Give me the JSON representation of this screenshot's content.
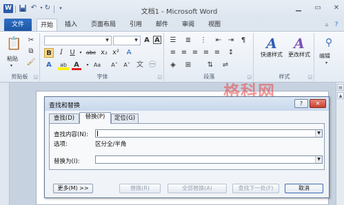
{
  "window": {
    "title": "文档1 - Microsoft Word",
    "logo_letter": "W",
    "qat": [
      "save-icon",
      "undo-icon",
      "redo-icon",
      "customize-icon"
    ],
    "controls": [
      "minimize",
      "maximize",
      "close"
    ]
  },
  "ribbon": {
    "file_tab": "文件",
    "tabs": [
      "开始",
      "插入",
      "页面布局",
      "引用",
      "邮件",
      "审阅",
      "视图"
    ],
    "active_tab": "开始",
    "groups": {
      "clipboard": {
        "paste": "粘贴",
        "label": "剪贴板"
      },
      "font": {
        "label": "字体",
        "bold": "B",
        "italic": "I",
        "underline": "U",
        "strike": "abc",
        "subscript": "x₂",
        "superscript": "x²",
        "grow": "A˄",
        "shrink": "A˅",
        "case": "Aa",
        "clear": "A",
        "font_color": "A",
        "highlight": "ab",
        "char_border": "A",
        "text_effects": "A"
      },
      "paragraph": {
        "label": "段落"
      },
      "styles": {
        "label": "样式",
        "quick_styles": "快速样式",
        "change_styles": "更改样式"
      },
      "editing": {
        "label": "编辑"
      }
    }
  },
  "watermark": "格科网",
  "dialog": {
    "title": "查找和替换",
    "help": "?",
    "tabs": [
      "查找(D)",
      "替换(P)",
      "定位(G)"
    ],
    "active_tab": "替换(P)",
    "find_label": "查找内容(N):",
    "find_value": "",
    "options_label": "选项:",
    "options_value": "区分全/半角",
    "replace_label": "替换为(I):",
    "replace_value": "",
    "buttons": {
      "more": "更多(M) >>",
      "replace": "替换(R)",
      "replace_all": "全部替换(A)",
      "find_next": "查找下一处(F)",
      "cancel": "取消"
    }
  }
}
